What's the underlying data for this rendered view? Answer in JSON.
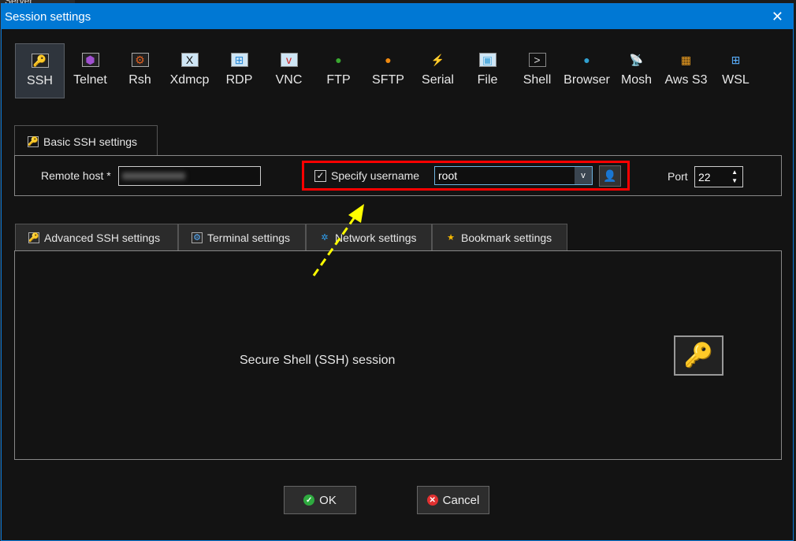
{
  "background_text": "Server",
  "dialog": {
    "title": "Session settings",
    "close_icon": "close-icon"
  },
  "protocols": [
    {
      "label": "SSH",
      "icon": "key-icon",
      "selected": true
    },
    {
      "label": "Telnet",
      "icon": "purple-gem-icon"
    },
    {
      "label": "Rsh",
      "icon": "gears-icon"
    },
    {
      "label": "Xdmcp",
      "icon": "x-monitor-icon"
    },
    {
      "label": "RDP",
      "icon": "windows-monitor-icon"
    },
    {
      "label": "VNC",
      "icon": "vnc-monitor-icon"
    },
    {
      "label": "FTP",
      "icon": "green-globe-icon"
    },
    {
      "label": "SFTP",
      "icon": "orange-globe-icon"
    },
    {
      "label": "Serial",
      "icon": "plug-icon"
    },
    {
      "label": "File",
      "icon": "monitor-icon"
    },
    {
      "label": "Shell",
      "icon": "terminal-icon"
    },
    {
      "label": "Browser",
      "icon": "globe-icon"
    },
    {
      "label": "Mosh",
      "icon": "satellite-icon"
    },
    {
      "label": "Aws S3",
      "icon": "cubes-icon"
    },
    {
      "label": "WSL",
      "icon": "windows-icon"
    }
  ],
  "basic": {
    "tab_label": "Basic SSH settings",
    "remote_host_label": "Remote host *",
    "specify_username_label": "Specify username",
    "specify_username_checked": true,
    "username": "root",
    "port_label": "Port",
    "port": "22"
  },
  "subtabs": [
    "Advanced SSH settings",
    "Terminal settings",
    "Network settings",
    "Bookmark settings"
  ],
  "main_text": "Secure Shell (SSH) session",
  "buttons": {
    "ok": "OK",
    "cancel": "Cancel"
  },
  "colors": {
    "titlebar": "#0078d4",
    "highlight": "#ff0000",
    "arrow": "#ffff00"
  }
}
